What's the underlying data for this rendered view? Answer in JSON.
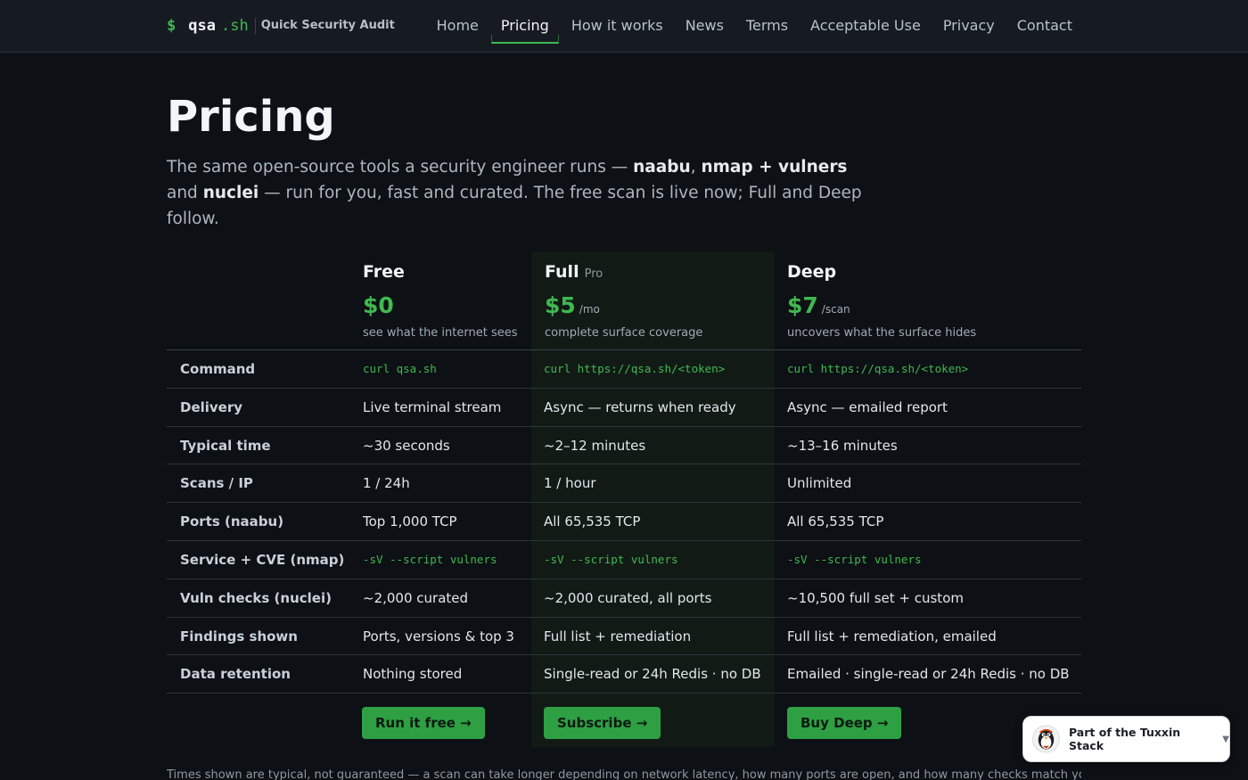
{
  "header": {
    "brand_symbol": "$",
    "brand_name": "qsa",
    "brand_tld": ".sh",
    "tagline": "Quick Security Audit",
    "nav": [
      {
        "label": "Home",
        "active": false
      },
      {
        "label": "Pricing",
        "active": true
      },
      {
        "label": "How it works",
        "active": false
      },
      {
        "label": "News",
        "active": false
      },
      {
        "label": "Terms",
        "active": false
      },
      {
        "label": "Acceptable Use",
        "active": false
      },
      {
        "label": "Privacy",
        "active": false
      },
      {
        "label": "Contact",
        "active": false
      }
    ]
  },
  "page": {
    "title": "Pricing",
    "intro": {
      "t1": "The same open-source tools a security engineer runs — ",
      "b1": "naabu",
      "t2": ", ",
      "b2": "nmap + vulners",
      "t3": " and ",
      "b3": "nuclei",
      "t4": " — run for you, fast and curated. The free scan is live now; Full and Deep follow."
    }
  },
  "plans": [
    {
      "name": "Free",
      "badge": "",
      "amount": "$0",
      "unit": "",
      "desc": "see what the internet sees",
      "cta": "Run it free →"
    },
    {
      "name": "Full",
      "badge": "Pro",
      "amount": "$5",
      "unit": "/mo",
      "desc": "complete surface coverage",
      "cta": "Subscribe →"
    },
    {
      "name": "Deep",
      "badge": "",
      "amount": "$7",
      "unit": "/scan",
      "desc": "uncovers what the surface hides",
      "cta": "Buy Deep →"
    }
  ],
  "rows": [
    {
      "label": "Command",
      "mono": true,
      "values": [
        "curl qsa.sh",
        "curl https://qsa.sh/<token>",
        "curl https://qsa.sh/<token>"
      ]
    },
    {
      "label": "Delivery",
      "mono": false,
      "values": [
        "Live terminal stream",
        "Async — returns when ready",
        "Async — emailed report"
      ]
    },
    {
      "label": "Typical time",
      "mono": false,
      "values": [
        "~30 seconds",
        "~2–12 minutes",
        "~13–16 minutes"
      ]
    },
    {
      "label": "Scans / IP",
      "mono": false,
      "values": [
        "1 / 24h",
        "1 / hour",
        "Unlimited"
      ]
    },
    {
      "label": "Ports (naabu)",
      "mono": false,
      "values": [
        "Top 1,000 TCP",
        "All 65,535 TCP",
        "All 65,535 TCP"
      ]
    },
    {
      "label": "Service + CVE (nmap)",
      "mono": true,
      "values": [
        "-sV --script vulners",
        "-sV --script vulners",
        "-sV --script vulners"
      ]
    },
    {
      "label": "Vuln checks (nuclei)",
      "mono": false,
      "values": [
        "~2,000 curated",
        "~2,000 curated, all ports",
        "~10,500 full set + custom"
      ]
    },
    {
      "label": "Findings shown",
      "mono": false,
      "values": [
        "Ports, versions & top 3",
        "Full list + remediation",
        "Full list + remediation, emailed"
      ]
    },
    {
      "label": "Data retention",
      "mono": false,
      "values": [
        "Nothing stored",
        "Single-read or 24h Redis · no DB",
        "Emailed · single-read or 24h Redis · no DB"
      ]
    }
  ],
  "footnote": "Times shown are typical, not guaranteed — a scan can take longer depending on network latency, how many ports are open, and how many checks match your",
  "stack_badge": {
    "label": "Part of the Tuxxin Stack",
    "caret": "▼",
    "icon": "penguin-icon"
  },
  "colors": {
    "accent": "#3fb950",
    "background": "#0d1014",
    "header_bg": "#161b22"
  }
}
